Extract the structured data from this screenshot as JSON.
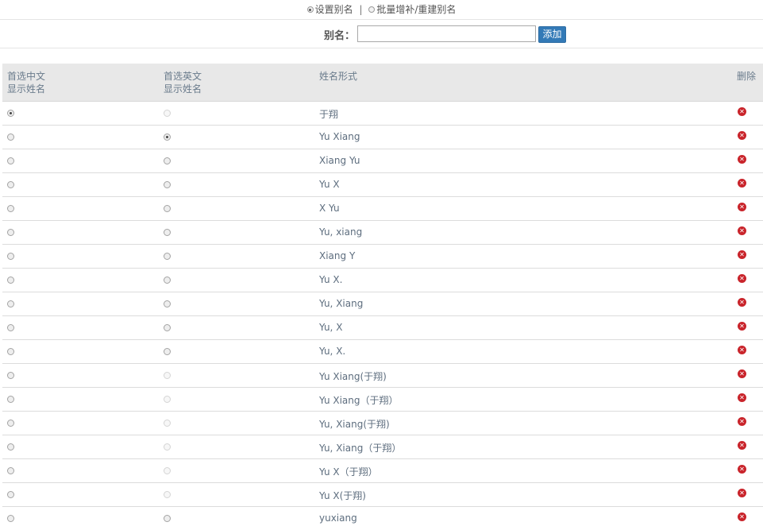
{
  "mode_bar": {
    "option1": "设置别名",
    "separator": "|",
    "option2": "批量增补/重建别名"
  },
  "alias_bar": {
    "label": "别名：",
    "input_value": "",
    "add_button": "添加"
  },
  "table": {
    "headers": {
      "zh_line1": "首选中文",
      "zh_line2": "显示姓名",
      "en_line1": "首选英文",
      "en_line2": "显示姓名",
      "name_form": "姓名形式",
      "delete": "删除"
    },
    "rows": [
      {
        "name": "于翔",
        "zh_state": "on",
        "en_state": "dis"
      },
      {
        "name": "Yu Xiang",
        "zh_state": "off",
        "en_state": "on"
      },
      {
        "name": "Xiang Yu",
        "zh_state": "off",
        "en_state": "off"
      },
      {
        "name": "Yu X",
        "zh_state": "off",
        "en_state": "off"
      },
      {
        "name": "X Yu",
        "zh_state": "off",
        "en_state": "off"
      },
      {
        "name": "Yu, xiang",
        "zh_state": "off",
        "en_state": "off"
      },
      {
        "name": "Xiang Y",
        "zh_state": "off",
        "en_state": "off"
      },
      {
        "name": "Yu X.",
        "zh_state": "off",
        "en_state": "off"
      },
      {
        "name": "Yu, Xiang",
        "zh_state": "off",
        "en_state": "off"
      },
      {
        "name": "Yu, X",
        "zh_state": "off",
        "en_state": "off"
      },
      {
        "name": "Yu, X.",
        "zh_state": "off",
        "en_state": "off"
      },
      {
        "name": "Yu Xiang(于翔)",
        "zh_state": "off",
        "en_state": "dis"
      },
      {
        "name": "Yu Xiang（于翔）",
        "zh_state": "off",
        "en_state": "dis"
      },
      {
        "name": "Yu, Xiang(于翔)",
        "zh_state": "off",
        "en_state": "dis"
      },
      {
        "name": "Yu, Xiang（于翔）",
        "zh_state": "off",
        "en_state": "dis"
      },
      {
        "name": "Yu X（于翔）",
        "zh_state": "off",
        "en_state": "dis"
      },
      {
        "name": "Yu X(于翔)",
        "zh_state": "off",
        "en_state": "dis"
      },
      {
        "name": "yuxiang",
        "zh_state": "off",
        "en_state": "off"
      }
    ],
    "delete_icon": "close-circle-icon",
    "delete_color": "#c9242b"
  },
  "colors": {
    "accent": "#337ab7",
    "header_bg": "#e8e8e8"
  }
}
